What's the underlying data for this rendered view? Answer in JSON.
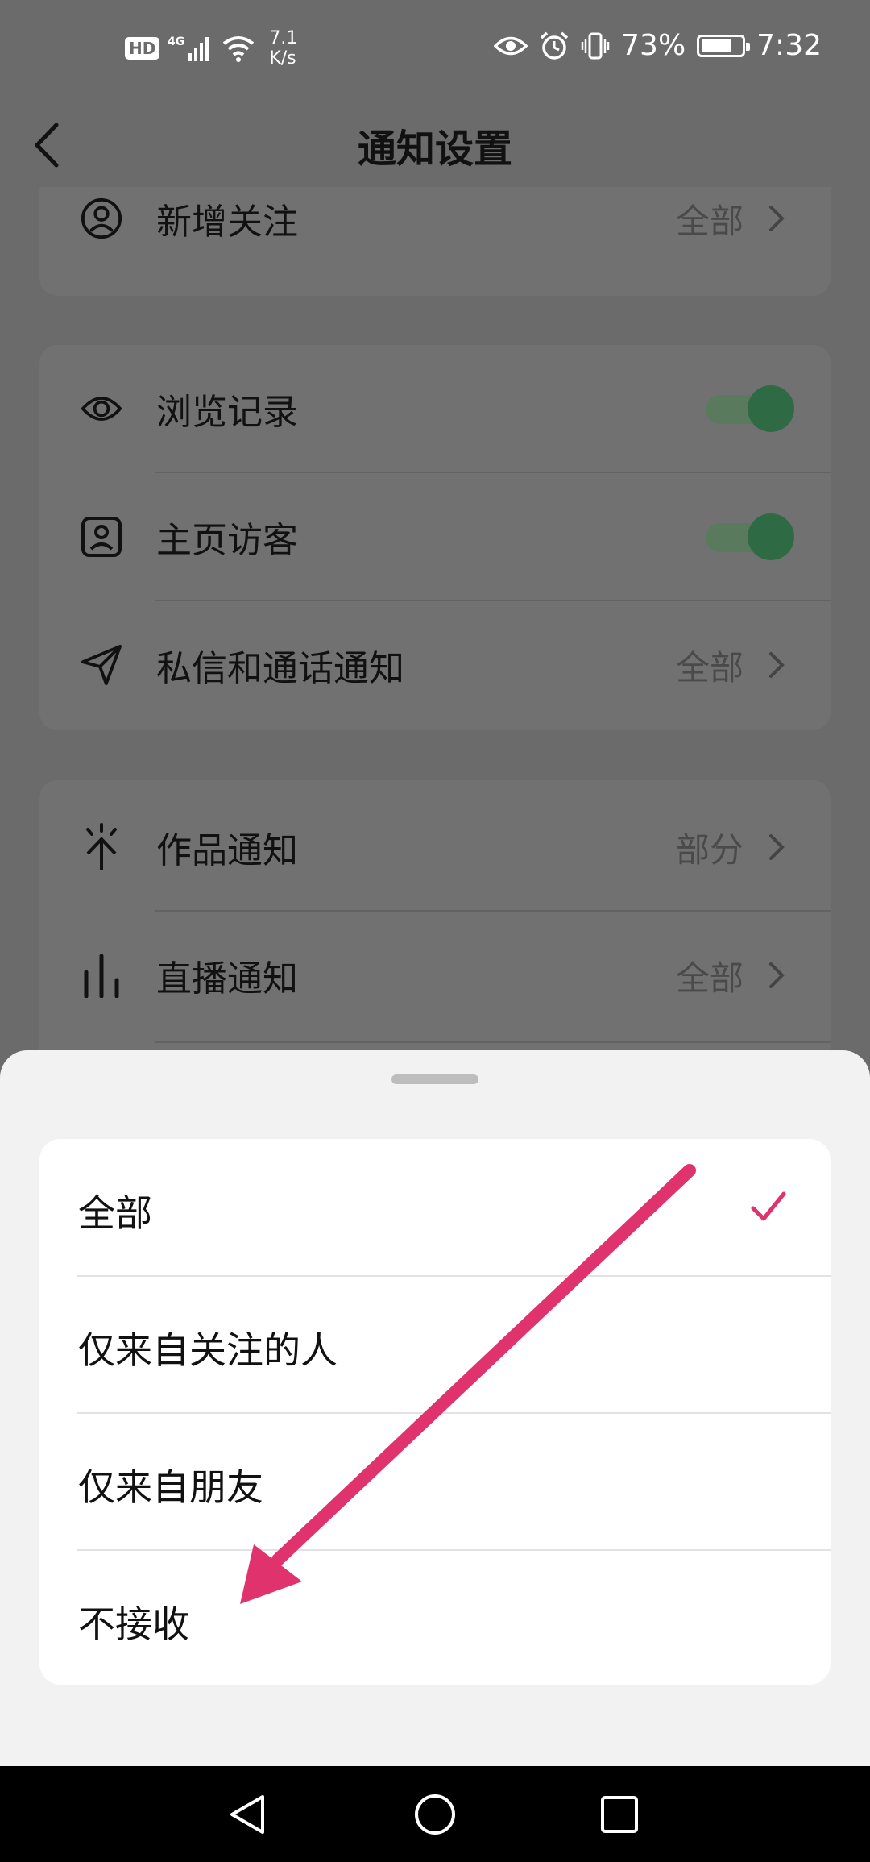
{
  "status_bar": {
    "hd": "HD",
    "network": "4G",
    "speed_value": "7.1",
    "speed_unit": "K/s",
    "battery": "73%",
    "time": "7:32",
    "icons": [
      "eye-icon",
      "alarm-icon",
      "vibrate-icon",
      "battery-icon",
      "signal-icon",
      "wifi-icon"
    ]
  },
  "header": {
    "title": "通知设置",
    "back_icon": "back-arrow-icon"
  },
  "settings": {
    "follow": {
      "label": "新增关注",
      "value": "全部",
      "icon": "user-circle-icon"
    },
    "browse": {
      "label": "浏览记录",
      "enabled": true,
      "icon": "eye-icon"
    },
    "visitors": {
      "label": "主页访客",
      "enabled": true,
      "icon": "profile-icon"
    },
    "messages": {
      "label": "私信和通话通知",
      "value": "全部",
      "icon": "send-icon"
    },
    "works": {
      "label": "作品通知",
      "value": "部分",
      "icon": "spark-icon"
    },
    "live": {
      "label": "直播通知",
      "value": "全部",
      "icon": "bars-icon"
    }
  },
  "sheet": {
    "options": [
      {
        "label": "全部",
        "selected": true
      },
      {
        "label": "仅来自关注的人",
        "selected": false
      },
      {
        "label": "仅来自朋友",
        "selected": false
      },
      {
        "label": "不接收",
        "selected": false
      }
    ]
  },
  "colors": {
    "accent": "#e0336e",
    "toggle_on": "#2e6b45",
    "overlay_bg": "#6b6b6b",
    "sheet_bg": "#f2f2f2"
  },
  "nav": {
    "icons": [
      "back-triangle-icon",
      "home-circle-icon",
      "recents-square-icon"
    ]
  }
}
